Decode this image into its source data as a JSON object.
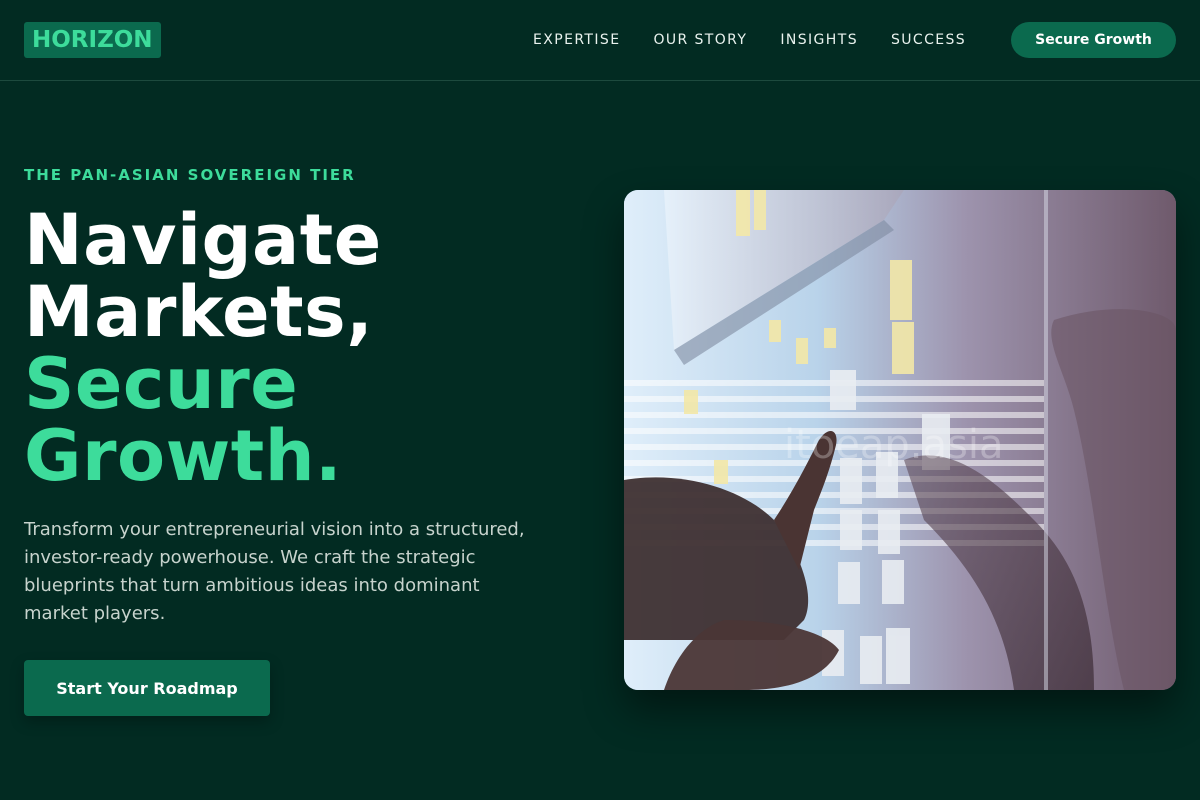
{
  "brand": {
    "logo_text": "HORIZON"
  },
  "nav": {
    "links": [
      "EXPERTISE",
      "OUR STORY",
      "INSIGHTS",
      "SUCCESS"
    ],
    "cta_label": "Secure Growth"
  },
  "hero": {
    "eyebrow": "THE PAN-ASIAN SOVEREIGN TIER",
    "headline_lines": [
      "Navigate",
      "Markets,"
    ],
    "headline_accent_lines": [
      "Secure",
      "Growth."
    ],
    "description": "Transform your entrepreneurial vision into a structured, investor-ready powerhouse. We craft the strategic blueprints that turn ambitious ideas into dominant market players.",
    "cta_label": "Start Your Roadmap",
    "image_watermark": "itoeap.asia"
  },
  "colors": {
    "background": "#022b22",
    "accent": "#3ddc9b",
    "button": "#0b6a4e",
    "text": "#ffffff",
    "muted_text": "#c7d3cd"
  }
}
